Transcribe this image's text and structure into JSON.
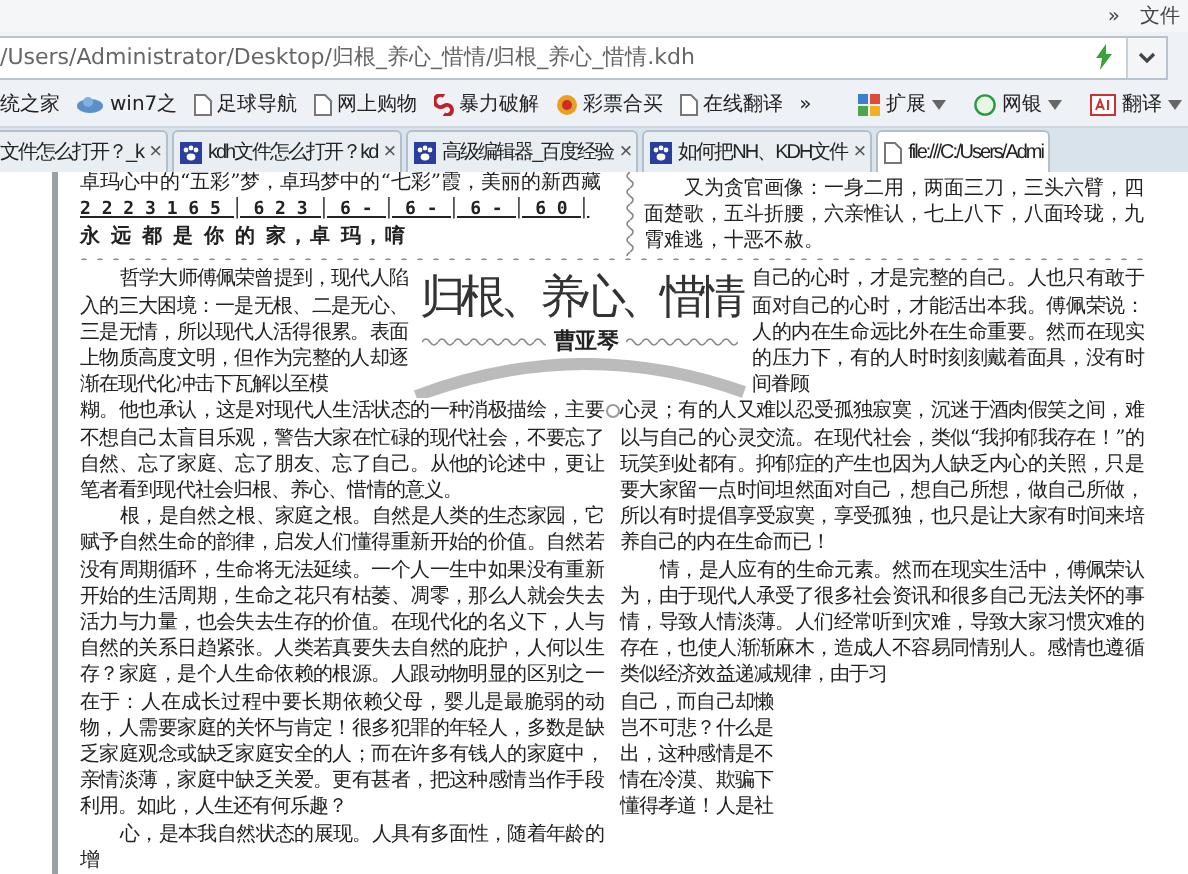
{
  "top_bar": {
    "overflow": "»",
    "menu": "文件"
  },
  "address_bar": {
    "value": "/Users/Administrator/Desktop/归根_养心_惜情/归根_养心_惜情.kdh"
  },
  "bookmarks": [
    {
      "label": "统之家",
      "kind": "none"
    },
    {
      "label": "win7之",
      "kind": "cloud"
    },
    {
      "label": "足球导航",
      "kind": "page"
    },
    {
      "label": "网上购物",
      "kind": "page"
    },
    {
      "label": "暴力破解",
      "kind": "swirl"
    },
    {
      "label": "彩票合买",
      "kind": "ball"
    },
    {
      "label": "在线翻译",
      "kind": "page"
    }
  ],
  "bookmarks_overflow": "»",
  "extensions": [
    {
      "label": "扩展",
      "kind": "grid"
    },
    {
      "label": "网银",
      "kind": "coin"
    },
    {
      "label": "翻译",
      "kind": "ad"
    }
  ],
  "tabs": [
    {
      "label": "文件怎么打开？_k",
      "close": "×",
      "selected": false,
      "kind": "none"
    },
    {
      "label": "kdh文件怎么打开？kd",
      "close": "×",
      "selected": false,
      "kind": "paw"
    },
    {
      "label": "高级编辑器_百度经验",
      "close": "×",
      "selected": false,
      "kind": "paw"
    },
    {
      "label": "如何把NH、KDH文件",
      "close": "×",
      "selected": false,
      "kind": "paw"
    },
    {
      "label": "file:///C:/Users/Admi",
      "selected": true,
      "kind": "page"
    }
  ],
  "document": {
    "song_line": "卓玛心中的“五彩”梦，卓玛梦中的“七彩”霞，美丽的新西藏",
    "notation": "2 2 2 3 1 6 5 │ 6 2 3 │ 6 - │ 6 - │ 6 - │ 6 0 │",
    "lyrics": "永 远 都 是 你 的 家，卓 玛，唷",
    "poem": "又为贪官画像：一身二用，两面三刀，三头六臂，四面楚歌，五斗折腰，六亲惟认，七上八下，八面玲珑，九霄难逃，十恶不赦。",
    "title": "归根、养心、惜情",
    "author": "曹亚琴",
    "left_beside_title": {
      "text": "哲学大师傅佩荣曾提到，现代人陷入的三大困境：一是无根、二是无心、三是无情，所以现代人活得很累。表面上物质高度文明，但作为完整的人却逐渐在现代化冲击下瓦解以至模",
      "indent": true
    },
    "right_beside_title": {
      "text": "自己的心时，才是完整的自己。人也只有敢于面对自己的心时，才能活出本我。傅佩荣说：人的内在生命远比外在生命重要。然而在现实的压力下，有的人时时刻刻戴着面具，没有时间眷顾",
      "indent": false
    },
    "left_paragraphs": [
      {
        "text": "糊。他也承认，这是对现代人生活状态的一种消极描绘，主要不想自己太盲目乐观，警告大家在忙碌的现代社会，不要忘了自然、忘了家庭、忘了朋友、忘了自己。从他的论述中，更让笔者看到现代社会归根、养心、惜情的意义。",
        "indent": false
      },
      {
        "text": "根，是自然之根、家庭之根。自然是人类的生态家园，它赋予自然生命的韵律，启发人们懂得重新开始的价值。自然若没有周期循环，生命将无法延续。一个人一生中如果没有重新开始的生活周期，生命之花只有枯萎、凋零，那么人就会失去活力与力量，也会失去生存的价值。在现代化的名义下，人与自然的关系日趋紧张。人类若真要失去自然的庇护，人何以生存？家庭，是个人生命依赖的根源。人跟动物明显的区别之一在于：人在成长过程中要长期依赖父母，婴儿是最脆弱的动物，人需要家庭的关怀与肯定！很多犯罪的年轻人，多数是缺乏家庭观念或缺乏家庭安全的人；而在许多有钱人的家庭中，亲情淡薄，家庭中缺乏关爱。更有甚者，把这种感情当作手段利用。如此，人生还有何乐趣？",
        "indent": true
      },
      {
        "text": "心，是本我自然状态的展现。人具有多面性，随着年龄的增",
        "indent": true
      }
    ],
    "right_paragraphs": [
      {
        "text": "心灵；有的人又难以忍受孤独寂寞，沉迷于酒肉假笑之间，难以与自己的心灵交流。在现代社会，类似“我抑郁我存在！”的玩笑到处都有。抑郁症的产生也因为人缺乏内心的关照，只是要大家留一点时间坦然面对自己，想自己所想，做自己所做，所以有时提倡享受寂寞，享受孤独，也只是让大家有时间来培养自己的内在生命而已！",
        "indent": false
      },
      {
        "text": "情，是人应有的生命元素。然而在现实生活中，傅佩荣认为，由于现代人承受了很多社会资讯和很多自己无法关怀的事情，导致人情淡薄。人们经常听到灾难，导致大家习惯灾难的存在，也使人渐渐麻木，造成人不容易同情别人。感情也遵循类似经济效益递减规律，由于习",
        "indent": true
      }
    ],
    "right_fragments": [
      "自己，而自己却懒",
      "岂不可悲？什么是",
      "出，这种感情是不",
      "情在冷漠、欺骗下",
      "懂得孝道！人是社"
    ]
  }
}
